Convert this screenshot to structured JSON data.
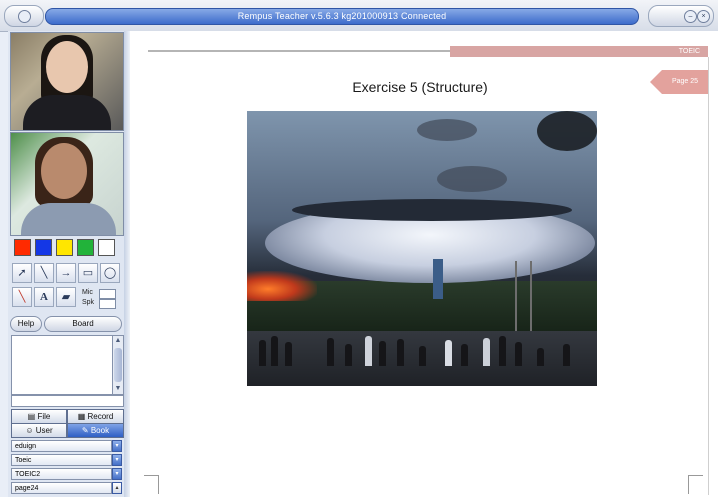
{
  "window": {
    "title": "Rempus Teacher v.5.6.3   kg201000913 Connected"
  },
  "colors": {
    "titlebar_accent": "#3d6ccb",
    "page_tab": "#e3a29d",
    "header_bar": "#d8a5a3"
  },
  "palette": [
    "#ff2a00",
    "#1437e6",
    "#ffe600",
    "#22b33a",
    "#ffffff"
  ],
  "tools": {
    "pointer_icon": "pointer-icon",
    "line_icon": "line-icon",
    "arrow_icon": "arrow-icon",
    "rect_icon": "rectangle-icon",
    "ellipse_icon": "ellipse-icon",
    "pen_icon": "pen-icon",
    "text_glyph": "A",
    "eraser_icon": "eraser-icon",
    "mic_label": "Mic",
    "spk_label": "Spk"
  },
  "buttons": {
    "help": "Help",
    "board": "Board",
    "file": "File",
    "record": "Record",
    "user": "User",
    "book": "Book"
  },
  "book_list": {
    "items": [
      "eduign",
      "Toeic",
      "TOEIC2",
      "page24"
    ]
  },
  "document": {
    "header_tag": "TOEIC",
    "page_label": "Page 25",
    "heading": "Exercise 5 (Structure)"
  }
}
